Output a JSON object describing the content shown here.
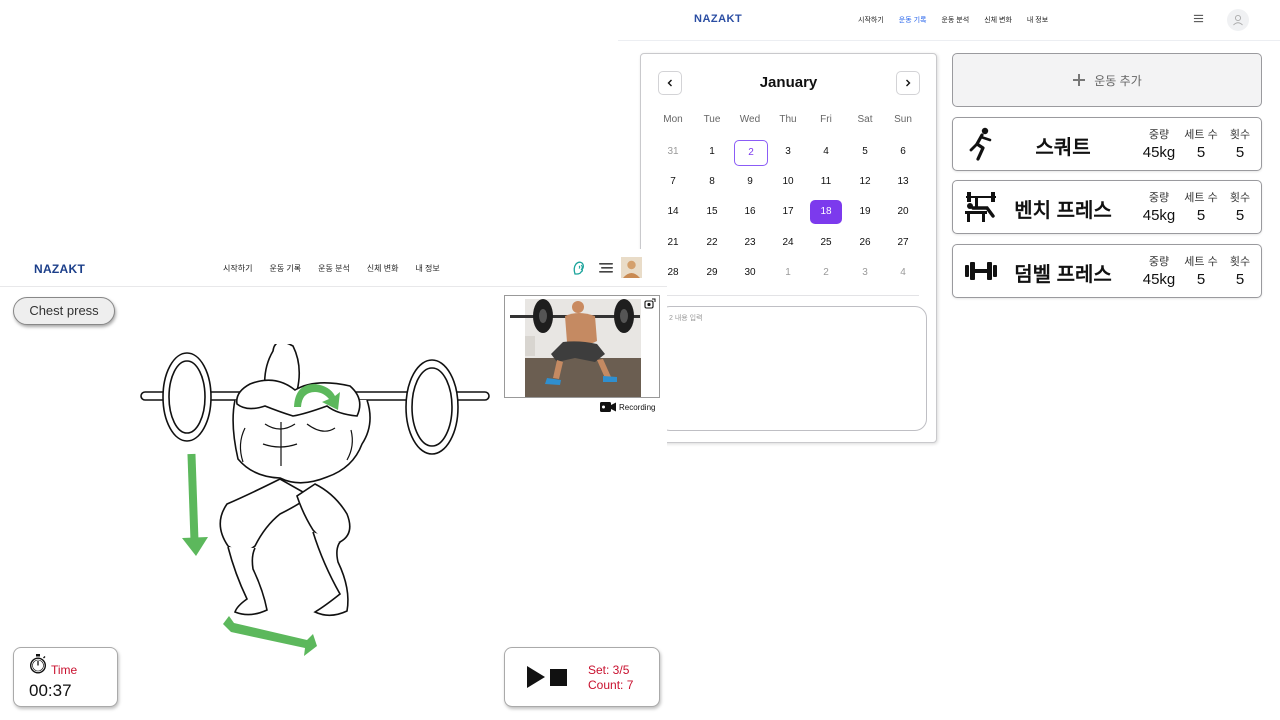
{
  "right_app": {
    "logo": "NAZAKT",
    "nav": [
      "시작하기",
      "운동 기록",
      "운동 분석",
      "신체 변화",
      "내 정보"
    ],
    "nav_active_index": 1,
    "calendar": {
      "month": "January",
      "weekdays": [
        "Mon",
        "Tue",
        "Wed",
        "Thu",
        "Fri",
        "Sat",
        "Sun"
      ],
      "weeks": [
        [
          "31",
          "1",
          "2",
          "3",
          "4",
          "5",
          "6"
        ],
        [
          "7",
          "8",
          "9",
          "10",
          "11",
          "12",
          "13"
        ],
        [
          "14",
          "15",
          "16",
          "17",
          "18",
          "19",
          "20"
        ],
        [
          "21",
          "22",
          "23",
          "24",
          "25",
          "26",
          "27"
        ],
        [
          "28",
          "29",
          "30",
          "1",
          "2",
          "3",
          "4"
        ]
      ],
      "today": "2",
      "selected": "18",
      "accent_color": "#7c3aed",
      "memo_placeholder": "2 내용 입력"
    },
    "add_workout_label": "운동 추가",
    "exercises": [
      {
        "name": "스쿼트",
        "icon": "squat-icon",
        "weight_label": "중량",
        "weight": "45kg",
        "sets_label": "세트 수",
        "sets": "5",
        "reps_label": "횟수",
        "reps": "5"
      },
      {
        "name": "벤치 프레스",
        "icon": "bench-press-icon",
        "weight_label": "중량",
        "weight": "45kg",
        "sets_label": "세트 수",
        "sets": "5",
        "reps_label": "횟수",
        "reps": "5"
      },
      {
        "name": "덤벨 프레스",
        "icon": "dumbbell-icon",
        "weight_label": "중량",
        "weight": "45kg",
        "sets_label": "세트 수",
        "sets": "5",
        "reps_label": "횟수",
        "reps": "5"
      }
    ]
  },
  "left_app": {
    "logo": "NAZAKT",
    "nav": [
      "시작하기",
      "운동 기록",
      "운동 분석",
      "신체 변화",
      "내 정보"
    ],
    "exercise_button": "Chest press",
    "recording_label": "Recording",
    "time_label": "Time",
    "time_value": "00:37",
    "set_text": "Set: 3/5",
    "count_text": "Count: 7",
    "accent_red": "#c8102e",
    "arrow_green": "#5cb85c"
  }
}
